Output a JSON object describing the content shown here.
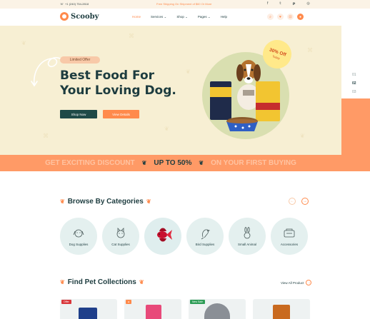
{
  "topbar": {
    "phone": "+1 (240) 754-2818",
    "promo": "Free Shipping On Shipment of $60 Or More",
    "social": [
      "facebook-icon",
      "twitter-icon",
      "pinterest-icon",
      "instagram-icon"
    ]
  },
  "brand": {
    "name": "Scooby",
    "accent": "#ff8a4c",
    "dark": "#1d3c3f"
  },
  "nav": {
    "home": "Home",
    "services": "Services",
    "shop": "Shop",
    "pages": "Pages",
    "help": "Help"
  },
  "hero": {
    "badge": "Limited Offer",
    "title_line1": "Best Food For",
    "title_line2": "Your Loving Dog.",
    "shop_now": "Shop Now",
    "view_details": "View Details",
    "sticker_line1": "30% Off",
    "sticker_line2": "Today",
    "slides": [
      "01",
      "02",
      "03"
    ],
    "current_slide": "02"
  },
  "strip": {
    "left": "GET EXCITING DISCOUNT",
    "middle": "UP TO 50%",
    "right": "ON YOUR FIRST BUYING"
  },
  "categories": {
    "title": "Browse By Categories",
    "items": [
      {
        "label": "Dog Supplies",
        "icon": "dog-icon"
      },
      {
        "label": "Cat Supplies",
        "icon": "cat-icon"
      },
      {
        "label": "",
        "icon": "fish-icon"
      },
      {
        "label": "Bird Supplies",
        "icon": "bird-icon"
      },
      {
        "label": "Small Animal",
        "icon": "rabbit-icon"
      },
      {
        "label": "Accessories",
        "icon": "accessories-icon"
      }
    ]
  },
  "collections": {
    "title": "Find Pet Collections",
    "view_all": "View All Product",
    "tags": [
      "Offer",
      "New Sale"
    ]
  }
}
